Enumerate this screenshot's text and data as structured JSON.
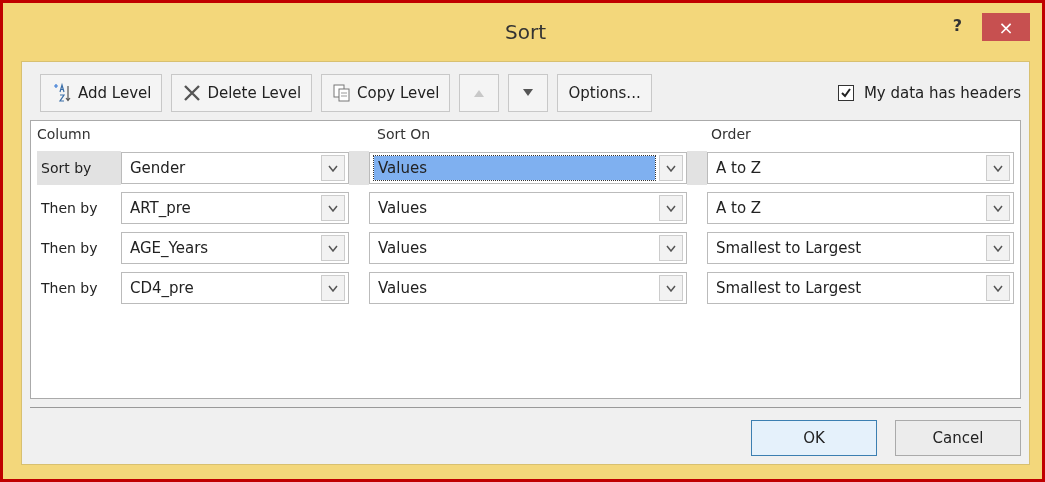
{
  "window": {
    "title": "Sort",
    "help": "?",
    "close": "×"
  },
  "toolbar": [
    {
      "kind": "add",
      "label": "Add Level",
      "disabled": false
    },
    {
      "kind": "delete",
      "label": "Delete Level",
      "disabled": false
    },
    {
      "kind": "copy",
      "label": "Copy Level",
      "disabled": false
    },
    {
      "kind": "up",
      "disabled": true
    },
    {
      "kind": "down",
      "disabled": false
    },
    {
      "kind": "text",
      "label": "Options...",
      "disabled": false
    }
  ],
  "headers_checkbox": {
    "label": "My data has headers",
    "checked": true
  },
  "columns": [
    "Column",
    "Sort On",
    "Order"
  ],
  "rows": [
    {
      "label": "Sort by",
      "column": "Gender",
      "sort_on": "Values",
      "order": "A to Z",
      "selected": true
    },
    {
      "label": "Then by",
      "column": "ART_pre",
      "sort_on": "Values",
      "order": "A to Z",
      "selected": false
    },
    {
      "label": "Then by",
      "column": "AGE_Years",
      "sort_on": "Values",
      "order": "Smallest to Largest",
      "selected": false
    },
    {
      "label": "Then by",
      "column": "CD4_pre",
      "sort_on": "Values",
      "order": "Smallest to Largest",
      "selected": false
    }
  ],
  "buttons": [
    {
      "label": "OK",
      "default": true
    },
    {
      "label": "Cancel",
      "default": false
    }
  ]
}
